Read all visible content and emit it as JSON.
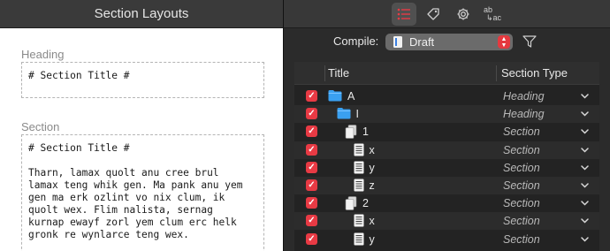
{
  "left_panel": {
    "title": "Section Layouts",
    "layouts": [
      {
        "label": "Heading",
        "preview": "# Section Title #"
      },
      {
        "label": "Section",
        "preview": "# Section Title #\n\nTharn, lamax quolt anu cree brul\nlamax teng whik gen. Ma pank anu yem\ngen ma erk ozlint vo nix clum, ik\nquolt wex. Flim nalista, sernag\nkurnap ewayf zorl yem clum erc helk\ngronk re wynlarce teng wex."
      }
    ]
  },
  "toolbar": {
    "buttons": [
      {
        "name": "section-types-list-icon",
        "active": true
      },
      {
        "name": "tag-icon",
        "active": false
      },
      {
        "name": "gear-icon",
        "active": false
      },
      {
        "name": "replacements-icon",
        "active": false,
        "top": "ab",
        "bottom": "ac"
      }
    ]
  },
  "compile": {
    "label": "Compile:",
    "format": "Draft"
  },
  "table": {
    "columns": [
      "Title",
      "Section Type"
    ],
    "rows": [
      {
        "title": "A",
        "icon": "folder",
        "level": 0,
        "section_type": "Heading",
        "checked": true
      },
      {
        "title": "I",
        "icon": "folder",
        "level": 1,
        "section_type": "Heading",
        "checked": true
      },
      {
        "title": "1",
        "icon": "stack",
        "level": 2,
        "section_type": "Section",
        "checked": true
      },
      {
        "title": "x",
        "icon": "doc",
        "level": 3,
        "section_type": "Section",
        "checked": true
      },
      {
        "title": "y",
        "icon": "doc",
        "level": 3,
        "section_type": "Section",
        "checked": true
      },
      {
        "title": "z",
        "icon": "doc",
        "level": 3,
        "section_type": "Section",
        "checked": true
      },
      {
        "title": "2",
        "icon": "stack",
        "level": 2,
        "section_type": "Section",
        "checked": true
      },
      {
        "title": "x",
        "icon": "doc",
        "level": 3,
        "section_type": "Section",
        "checked": true
      },
      {
        "title": "y",
        "icon": "doc",
        "level": 3,
        "section_type": "Section",
        "checked": true
      }
    ]
  },
  "colors": {
    "accent": "#e83a44",
    "folder": "#3aa0f0"
  }
}
